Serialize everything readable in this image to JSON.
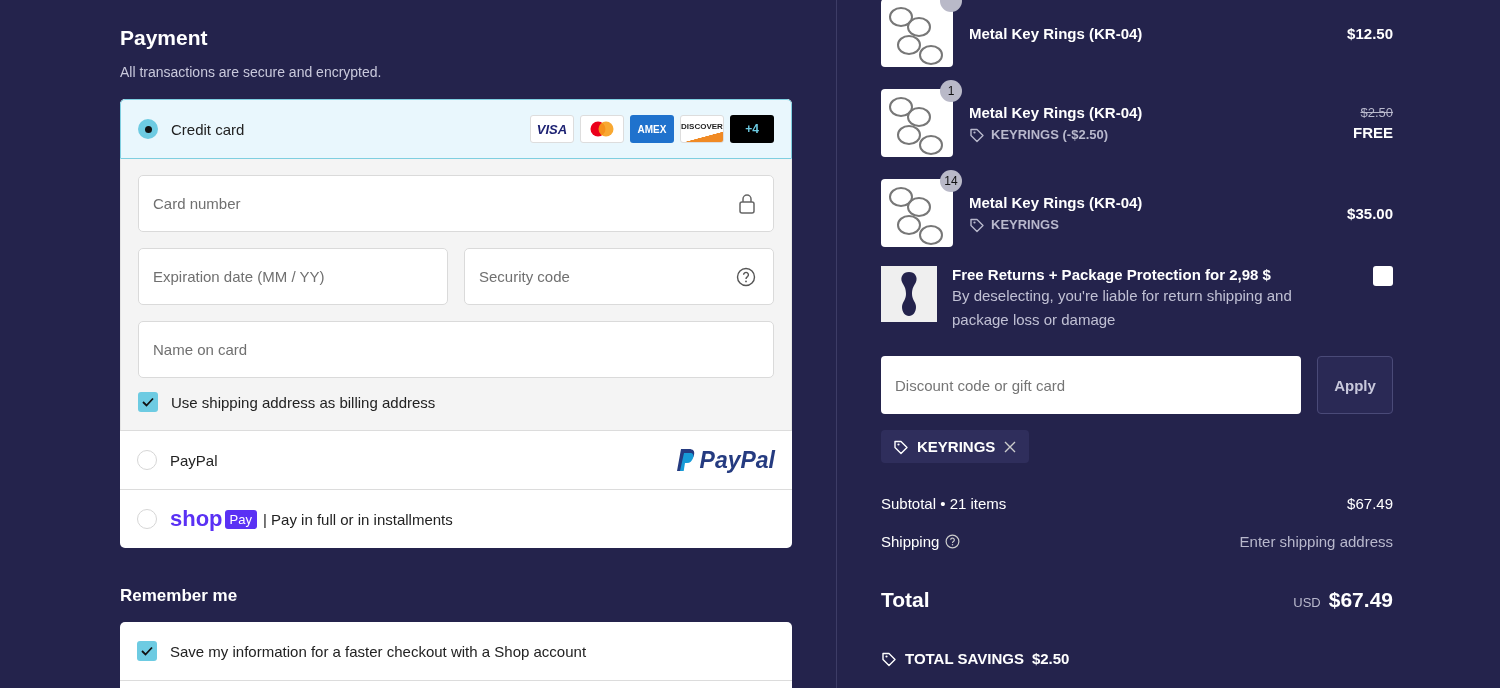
{
  "payment": {
    "title": "Payment",
    "subtitle": "All transactions are secure and encrypted.",
    "methods": [
      {
        "kind": "card",
        "label": "Credit card",
        "selected": true,
        "logos": [
          {
            "kind": "visa",
            "text": "VISA"
          },
          {
            "kind": "mastercard"
          },
          {
            "kind": "amex",
            "text": "AMEX"
          },
          {
            "kind": "discover",
            "text": "DISCOVER"
          },
          {
            "kind": "more",
            "text": "+4"
          }
        ]
      },
      {
        "kind": "paypal",
        "label": "PayPal",
        "selected": false,
        "logo": "PayPal"
      },
      {
        "kind": "shop",
        "label": "| Pay in full or in installments",
        "selected": false,
        "logo": "shop",
        "logo_badge": "Pay"
      }
    ],
    "card_fields": {
      "number": {
        "placeholder": "Card number"
      },
      "expiry": {
        "placeholder": "Expiration date (MM / YY)"
      },
      "security": {
        "placeholder": "Security code"
      },
      "name": {
        "placeholder": "Name on card"
      }
    },
    "billing_same": {
      "label": "Use shipping address as billing address",
      "checked": true
    }
  },
  "remember": {
    "title": "Remember me",
    "save": {
      "label": "Save my information for a faster checkout with a Shop account",
      "checked": true
    }
  },
  "items": [
    {
      "name": "Metal Key Rings (KR-04)",
      "price": "$12.50"
    },
    {
      "quantity": "1",
      "name": "Metal Key Rings (KR-04)",
      "discount": "KEYRINGS (-$2.50)",
      "old_price": "$2.50",
      "price": "FREE"
    },
    {
      "quantity": "14",
      "name": "Metal Key Rings (KR-04)",
      "discount": "KEYRINGS",
      "price": "$35.00"
    }
  ],
  "protection": {
    "title": "Free Returns + Package Protection for 2,98 $",
    "description": "By deselecting, you're liable for return shipping and package loss or damage",
    "checked": false
  },
  "discount": {
    "placeholder": "Discount code or gift card",
    "button": "Apply",
    "applied": [
      {
        "code": "KEYRINGS"
      }
    ]
  },
  "summary": {
    "subtotal_label": "Subtotal • 21 items",
    "subtotal": "$67.49",
    "shipping_label": "Shipping",
    "shipping": "Enter shipping address",
    "total_label": "Total",
    "currency": "USD",
    "total": "$67.49",
    "savings_label": "TOTAL SAVINGS",
    "savings": "$2.50"
  }
}
